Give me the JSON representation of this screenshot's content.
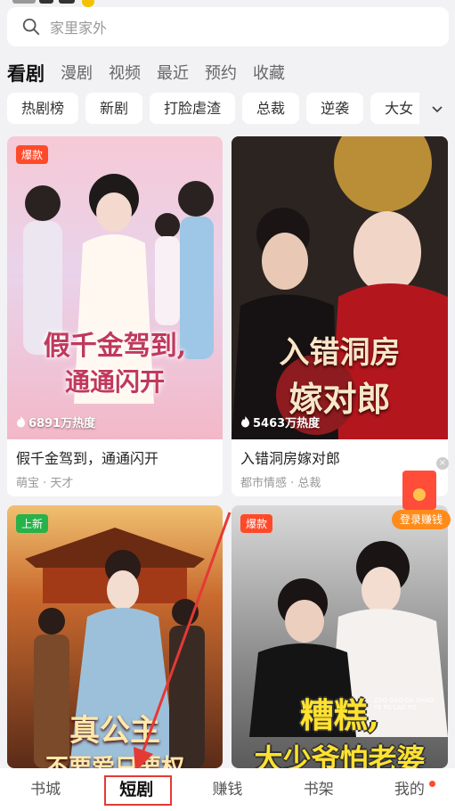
{
  "search": {
    "placeholder": "家里家外"
  },
  "top_tabs": [
    "看剧",
    "漫剧",
    "视频",
    "最近",
    "预约",
    "收藏"
  ],
  "chips": [
    "热剧榜",
    "新剧",
    "打脸虐渣",
    "总裁",
    "逆袭",
    "大女"
  ],
  "cards": [
    {
      "badge": "爆款",
      "badge_type": "hot",
      "heat": "6891万热度",
      "title": "假千金驾到，通通闪开",
      "tags": "萌宝 · 天才",
      "poster_line1": "假千金驾到,",
      "poster_line2": "通通闪开"
    },
    {
      "badge": "",
      "badge_type": "",
      "heat": "5463万热度",
      "title": "入错洞房嫁对郎",
      "tags": "都市情感 · 总裁",
      "poster_line1": "入错洞房",
      "poster_line2": "嫁对郎"
    },
    {
      "badge": "上新",
      "badge_type": "new",
      "heat": "",
      "title": "",
      "tags": "",
      "poster_line1": "真公主",
      "poster_line2": "不要爱只要权"
    },
    {
      "badge": "爆款",
      "badge_type": "hot",
      "heat": "",
      "title": "",
      "tags": "",
      "poster_line1": "糟糕,",
      "poster_line2": "大少爷怕老婆",
      "poster_small": "ZAO GAO DA SHAO YE PA LAO PO"
    }
  ],
  "float_coupon": {
    "label": "登录赚钱",
    "close": "×"
  },
  "bottom_nav": [
    "书城",
    "短剧",
    "赚钱",
    "书架",
    "我的"
  ],
  "colors": {
    "accent_red": "#e53935",
    "hot_badge": "#ff4a2a",
    "new_badge": "#27b24a"
  }
}
